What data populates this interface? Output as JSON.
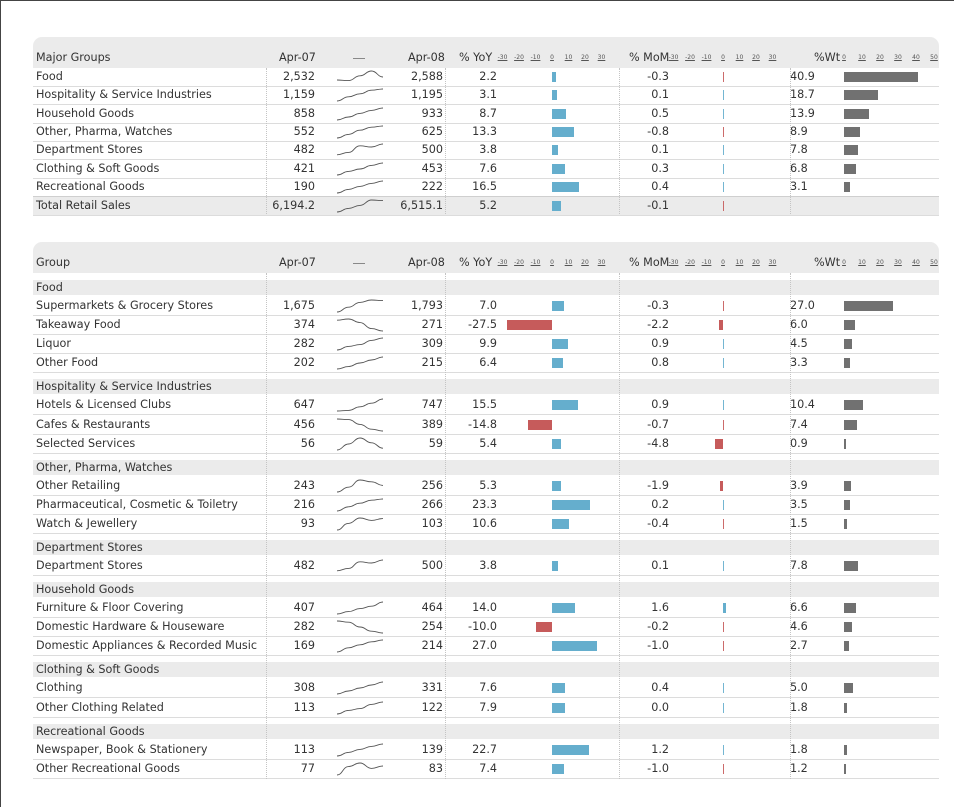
{
  "headers": {
    "apr07": "Apr-07",
    "apr08": "Apr-08",
    "yoy": "% YoY",
    "mom": "% MoM",
    "wt": "%Wt",
    "pct_ticks": [
      "-30",
      "-20",
      "-10",
      "0",
      "10",
      "20",
      "30"
    ],
    "wt_ticks": [
      "0",
      "10",
      "20",
      "30",
      "40",
      "50"
    ]
  },
  "chart_data": [
    {
      "type": "table",
      "first_column": "Major Groups",
      "columns": [
        "Apr-07",
        "Apr-08",
        "% YoY",
        "% MoM",
        "%Wt"
      ],
      "rows": [
        {
          "label": "Food",
          "apr07": "2,532",
          "apr08": "2,588",
          "yoy": "2.2",
          "mom": "-0.3",
          "wt": "40.9",
          "yoy_v": 2.2,
          "mom_v": -0.3,
          "wt_v": 40.9,
          "spark": [
            0.25,
            0.2,
            0.6,
            1.0,
            0.5
          ]
        },
        {
          "label": "Hospitality & Service Industries",
          "apr07": "1,159",
          "apr08": "1,195",
          "yoy": "3.1",
          "mom": "0.1",
          "wt": "18.7",
          "yoy_v": 3.1,
          "mom_v": 0.1,
          "wt_v": 18.7,
          "spark": [
            0.0,
            0.35,
            0.6,
            0.9,
            1.0
          ]
        },
        {
          "label": "Household Goods",
          "apr07": "858",
          "apr08": "933",
          "yoy": "8.7",
          "mom": "0.5",
          "wt": "13.9",
          "yoy_v": 8.7,
          "mom_v": 0.5,
          "wt_v": 13.9,
          "spark": [
            0.0,
            0.25,
            0.55,
            0.8,
            1.0
          ]
        },
        {
          "label": "Other, Pharma, Watches",
          "apr07": "552",
          "apr08": "625",
          "yoy": "13.3",
          "mom": "-0.8",
          "wt": "8.9",
          "yoy_v": 13.3,
          "mom_v": -0.8,
          "wt_v": 8.9,
          "spark": [
            0.0,
            0.3,
            0.65,
            0.9,
            1.0
          ]
        },
        {
          "label": "Department Stores",
          "apr07": "482",
          "apr08": "500",
          "yoy": "3.8",
          "mom": "0.1",
          "wt": "7.8",
          "yoy_v": 3.8,
          "mom_v": 0.1,
          "wt_v": 7.8,
          "spark": [
            0.1,
            0.3,
            0.85,
            0.75,
            1.0
          ]
        },
        {
          "label": "Clothing & Soft Goods",
          "apr07": "421",
          "apr08": "453",
          "yoy": "7.6",
          "mom": "0.3",
          "wt": "6.8",
          "yoy_v": 7.6,
          "mom_v": 0.3,
          "wt_v": 6.8,
          "spark": [
            0.0,
            0.3,
            0.5,
            0.8,
            1.0
          ]
        },
        {
          "label": "Recreational Goods",
          "apr07": "190",
          "apr08": "222",
          "yoy": "16.5",
          "mom": "0.4",
          "wt": "3.1",
          "yoy_v": 16.5,
          "mom_v": 0.4,
          "wt_v": 3.1,
          "spark": [
            0.0,
            0.3,
            0.55,
            0.8,
            1.0
          ]
        },
        {
          "label": "Total Retail Sales",
          "apr07": "6,194.2",
          "apr08": "6,515.1",
          "yoy": "5.2",
          "mom": "-0.1",
          "wt": "",
          "yoy_v": 5.2,
          "mom_v": -0.1,
          "wt_v": null,
          "spark": [
            0.0,
            0.3,
            0.55,
            1.0,
            0.95
          ],
          "total": true
        }
      ]
    },
    {
      "type": "table",
      "first_column": "Group",
      "columns": [
        "Apr-07",
        "Apr-08",
        "% YoY",
        "% MoM",
        "%Wt"
      ],
      "groups": [
        {
          "name": "Food",
          "rows": [
            {
              "label": "Supermarkets & Grocery Stores",
              "apr07": "1,675",
              "apr08": "1,793",
              "yoy": "7.0",
              "mom": "-0.3",
              "wt": "27.0",
              "yoy_v": 7.0,
              "mom_v": -0.3,
              "wt_v": 27.0,
              "spark": [
                0.0,
                0.4,
                0.8,
                1.0,
                0.95
              ]
            },
            {
              "label": "Takeaway Food",
              "apr07": "374",
              "apr08": "271",
              "yoy": "-27.5",
              "mom": "-2.2",
              "wt": "6.0",
              "yoy_v": -27.5,
              "mom_v": -2.2,
              "wt_v": 6.0,
              "spark": [
                0.9,
                1.0,
                0.7,
                0.2,
                0.0
              ]
            },
            {
              "label": "Liquor",
              "apr07": "282",
              "apr08": "309",
              "yoy": "9.9",
              "mom": "0.9",
              "wt": "4.5",
              "yoy_v": 9.9,
              "mom_v": 0.9,
              "wt_v": 4.5,
              "spark": [
                0.0,
                0.3,
                0.45,
                0.8,
                1.0
              ]
            },
            {
              "label": "Other Food",
              "apr07": "202",
              "apr08": "215",
              "yoy": "6.4",
              "mom": "0.8",
              "wt": "3.3",
              "yoy_v": 6.4,
              "mom_v": 0.8,
              "wt_v": 3.3,
              "spark": [
                0.0,
                0.2,
                0.5,
                0.75,
                1.0
              ]
            }
          ]
        },
        {
          "name": "Hospitality & Service Industries",
          "rows": [
            {
              "label": "Hotels & Licensed Clubs",
              "apr07": "647",
              "apr08": "747",
              "yoy": "15.5",
              "mom": "0.9",
              "wt": "10.4",
              "yoy_v": 15.5,
              "mom_v": 0.9,
              "wt_v": 10.4,
              "spark": [
                0.0,
                0.05,
                0.35,
                0.65,
                1.0
              ]
            },
            {
              "label": "Cafes & Restaurants",
              "apr07": "456",
              "apr08": "389",
              "yoy": "-14.8",
              "mom": "-0.7",
              "wt": "7.4",
              "yoy_v": -14.8,
              "mom_v": -0.7,
              "wt_v": 7.4,
              "spark": [
                1.0,
                0.95,
                0.55,
                0.15,
                0.0
              ]
            },
            {
              "label": "Selected Services",
              "apr07": "56",
              "apr08": "59",
              "yoy": "5.4",
              "mom": "-4.8",
              "wt": "0.9",
              "yoy_v": 5.4,
              "mom_v": -4.8,
              "wt_v": 0.9,
              "spark": [
                0.0,
                0.5,
                1.0,
                0.6,
                0.15
              ]
            }
          ]
        },
        {
          "name": "Other, Pharma, Watches",
          "rows": [
            {
              "label": "Other Retailing",
              "apr07": "243",
              "apr08": "256",
              "yoy": "5.3",
              "mom": "-1.9",
              "wt": "3.9",
              "yoy_v": 5.3,
              "mom_v": -1.9,
              "wt_v": 3.9,
              "spark": [
                0.0,
                0.4,
                1.0,
                0.85,
                0.55
              ]
            },
            {
              "label": "Pharmaceutical, Cosmetic & Toiletry",
              "apr07": "216",
              "apr08": "266",
              "yoy": "23.3",
              "mom": "0.2",
              "wt": "3.5",
              "yoy_v": 23.3,
              "mom_v": 0.2,
              "wt_v": 3.5,
              "spark": [
                0.0,
                0.35,
                0.65,
                0.9,
                1.0
              ]
            },
            {
              "label": "Watch & Jewellery",
              "apr07": "93",
              "apr08": "103",
              "yoy": "10.6",
              "mom": "-0.4",
              "wt": "1.5",
              "yoy_v": 10.6,
              "mom_v": -0.4,
              "wt_v": 1.5,
              "spark": [
                0.0,
                0.55,
                1.0,
                0.8,
                0.95
              ]
            }
          ]
        },
        {
          "name": "Department Stores",
          "rows": [
            {
              "label": "Department Stores",
              "apr07": "482",
              "apr08": "500",
              "yoy": "3.8",
              "mom": "0.1",
              "wt": "7.8",
              "yoy_v": 3.8,
              "mom_v": 0.1,
              "wt_v": 7.8,
              "spark": [
                0.1,
                0.3,
                0.85,
                0.75,
                1.0
              ]
            }
          ]
        },
        {
          "name": "Household Goods",
          "rows": [
            {
              "label": "Furniture & Floor Covering",
              "apr07": "407",
              "apr08": "464",
              "yoy": "14.0",
              "mom": "1.6",
              "wt": "6.6",
              "yoy_v": 14.0,
              "mom_v": 1.6,
              "wt_v": 6.6,
              "spark": [
                0.0,
                0.2,
                0.45,
                0.65,
                1.0
              ]
            },
            {
              "label": "Domestic Hardware & Houseware",
              "apr07": "282",
              "apr08": "254",
              "yoy": "-10.0",
              "mom": "-0.2",
              "wt": "4.6",
              "yoy_v": -10.0,
              "mom_v": -0.2,
              "wt_v": 4.6,
              "spark": [
                1.0,
                0.9,
                0.5,
                0.15,
                0.0
              ]
            },
            {
              "label": "Domestic Appliances & Recorded Music",
              "apr07": "169",
              "apr08": "214",
              "yoy": "27.0",
              "mom": "-1.0",
              "wt": "2.7",
              "yoy_v": 27.0,
              "mom_v": -1.0,
              "wt_v": 2.7,
              "spark": [
                0.0,
                0.35,
                0.6,
                0.85,
                1.0
              ]
            }
          ]
        },
        {
          "name": "Clothing & Soft Goods",
          "rows": [
            {
              "label": "Clothing",
              "apr07": "308",
              "apr08": "331",
              "yoy": "7.6",
              "mom": "0.4",
              "wt": "5.0",
              "yoy_v": 7.6,
              "mom_v": 0.4,
              "wt_v": 5.0,
              "spark": [
                0.0,
                0.25,
                0.5,
                0.75,
                1.0
              ]
            },
            {
              "label": "Other Clothing Related",
              "apr07": "113",
              "apr08": "122",
              "yoy": "7.9",
              "mom": "0.0",
              "wt": "1.8",
              "yoy_v": 7.9,
              "mom_v": 0.0,
              "wt_v": 1.8,
              "spark": [
                0.0,
                0.3,
                0.45,
                0.8,
                1.0
              ]
            }
          ]
        },
        {
          "name": "Recreational Goods",
          "rows": [
            {
              "label": "Newspaper, Book & Stationery",
              "apr07": "113",
              "apr08": "139",
              "yoy": "22.7",
              "mom": "1.2",
              "wt": "1.8",
              "yoy_v": 22.7,
              "mom_v": 1.2,
              "wt_v": 1.8,
              "spark": [
                0.0,
                0.3,
                0.55,
                0.8,
                1.0
              ]
            },
            {
              "label": "Other Recreational Goods",
              "apr07": "77",
              "apr08": "83",
              "yoy": "7.4",
              "mom": "-1.0",
              "wt": "1.2",
              "yoy_v": 7.4,
              "mom_v": -1.0,
              "wt_v": 1.2,
              "spark": [
                0.0,
                0.7,
                1.0,
                0.55,
                0.75
              ]
            }
          ]
        }
      ]
    }
  ],
  "colors": {
    "positive": "#65aecd",
    "negative": "#c65b5b",
    "weight": "#717171",
    "header_bg": "#ebebeb",
    "spark": "#555555"
  }
}
